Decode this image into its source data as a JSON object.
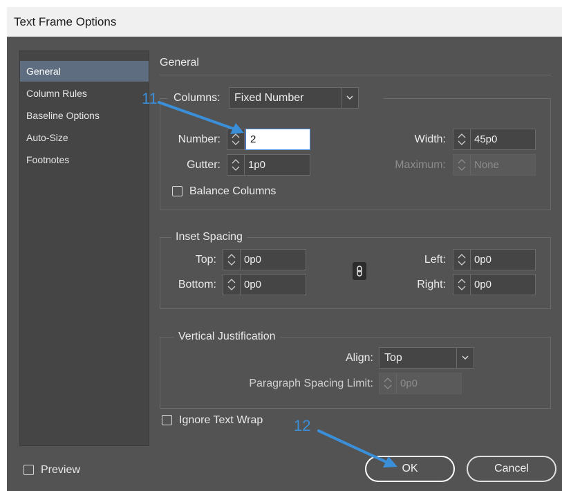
{
  "title": "Text Frame Options",
  "sidebar": {
    "items": [
      {
        "label": "General",
        "active": true
      },
      {
        "label": "Column Rules",
        "active": false
      },
      {
        "label": "Baseline Options",
        "active": false
      },
      {
        "label": "Auto-Size",
        "active": false
      },
      {
        "label": "Footnotes",
        "active": false
      }
    ]
  },
  "panel": {
    "title": "General"
  },
  "columns": {
    "label": "Columns:",
    "type": "Fixed Number",
    "number_label": "Number:",
    "number_value": "2",
    "width_label": "Width:",
    "width_value": "45p0",
    "gutter_label": "Gutter:",
    "gutter_value": "1p0",
    "maximum_label": "Maximum:",
    "maximum_value": "None",
    "balance_label": "Balance Columns"
  },
  "inset": {
    "title": "Inset Spacing",
    "top_label": "Top:",
    "top_value": "0p0",
    "bottom_label": "Bottom:",
    "bottom_value": "0p0",
    "left_label": "Left:",
    "left_value": "0p0",
    "right_label": "Right:",
    "right_value": "0p0"
  },
  "vertical": {
    "title": "Vertical Justification",
    "align_label": "Align:",
    "align_value": "Top",
    "psl_label": "Paragraph Spacing Limit:",
    "psl_value": "0p0"
  },
  "ignore_wrap_label": "Ignore Text Wrap",
  "preview_label": "Preview",
  "ok_label": "OK",
  "cancel_label": "Cancel",
  "annotations": {
    "step11": "11",
    "step12": "12"
  },
  "colors": {
    "accent_annotation": "#3a8fd8",
    "sidebar_selected": "#5f6d80",
    "dialog_bg": "#535353"
  }
}
